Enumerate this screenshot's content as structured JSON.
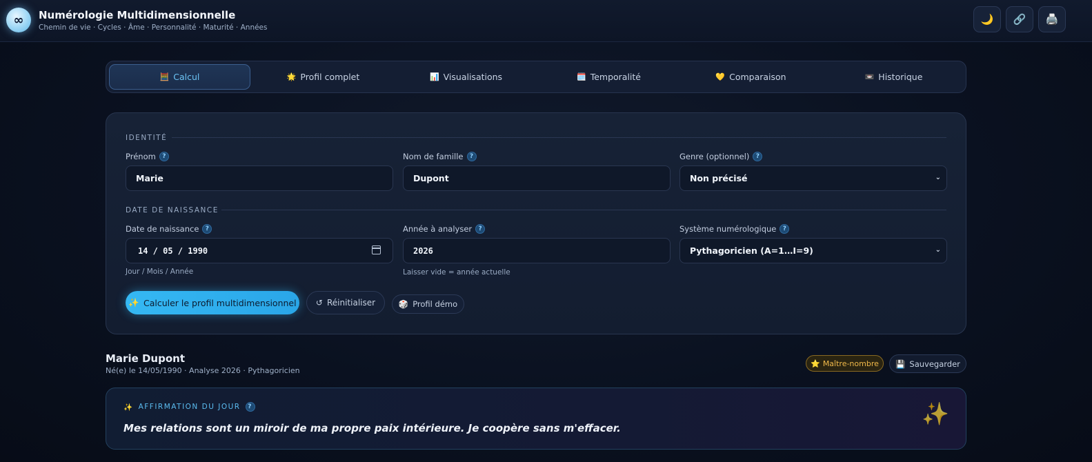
{
  "header": {
    "logo_glyph": "∞",
    "title": "Numérologie Multidimensionnelle",
    "subtitle": "Chemin de vie · Cycles · Âme · Personnalité · Maturité · Années",
    "buttons": [
      {
        "icon": "moon-icon",
        "glyph": "🌙"
      },
      {
        "icon": "link-icon",
        "glyph": "🔗"
      },
      {
        "icon": "printer-icon",
        "glyph": "🖨️"
      }
    ]
  },
  "tabs": [
    {
      "label": "Calcul",
      "icon": "🧮",
      "active": true
    },
    {
      "label": "Profil complet",
      "icon": "🌟",
      "active": false
    },
    {
      "label": "Visualisations",
      "icon": "📊",
      "active": false
    },
    {
      "label": "Temporalité",
      "icon": "🗓️",
      "active": false
    },
    {
      "label": "Comparaison",
      "icon": "💛",
      "active": false
    },
    {
      "label": "Historique",
      "icon": "📼",
      "active": false
    }
  ],
  "form": {
    "identity_section": "IDENTITÉ",
    "birth_section": "DATE DE NAISSANCE",
    "help_glyph": "?",
    "first_name": {
      "label": "Prénom",
      "value": "Marie"
    },
    "last_name": {
      "label": "Nom de famille",
      "value": "Dupont"
    },
    "gender": {
      "label": "Genre (optionnel)",
      "value": "Non précisé"
    },
    "birth_date": {
      "label": "Date de naissance",
      "value": "14 / 05 / 1990",
      "hint": "Jour / Mois / Année"
    },
    "year": {
      "label": "Année à analyser",
      "value": "2026",
      "hint": "Laisser vide = année actuelle"
    },
    "system": {
      "label": "Système numérologique",
      "value": "Pythagoricien (A=1…I=9)"
    },
    "calculate_label": "Calculer le profil multidimensionnel",
    "calculate_icon": "✨",
    "reset_label": "Réinitialiser",
    "reset_icon": "↺",
    "demo_label": "Profil démo",
    "demo_icon": "🎲"
  },
  "result": {
    "name": "Marie Dupont",
    "meta": "Né(e) le 14/05/1990 · Analyse 2026 · Pythagoricien",
    "badge_label": "Maître-nombre",
    "badge_icon": "⭐",
    "save_label": "Sauvegarder",
    "save_icon": "💾"
  },
  "affirmation": {
    "icon": "✨",
    "label": "AFFIRMATION DU JOUR",
    "text": "Mes relations sont un miroir de ma propre paix intérieure. Je coopère sans m'effacer.",
    "decor": "✨"
  },
  "colors": {
    "accent": "#35b8f3",
    "background": "#0a1120",
    "gold": "#f1b94a"
  }
}
